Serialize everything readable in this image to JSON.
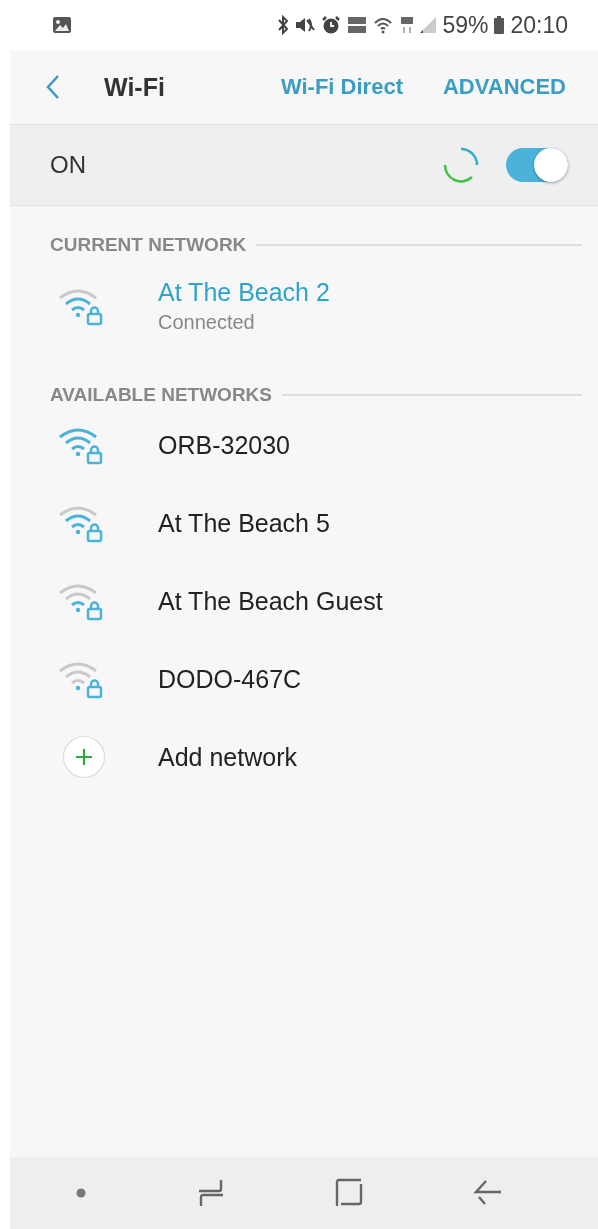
{
  "status_bar": {
    "battery": "59%",
    "time": "20:10"
  },
  "header": {
    "title": "Wi-Fi",
    "actions": [
      "Wi-Fi Direct",
      "ADVANCED"
    ]
  },
  "wifi_switch": {
    "label": "ON",
    "on": true
  },
  "current_section": {
    "heading": "CURRENT NETWORK",
    "network": {
      "name": "At The Beach 2",
      "status": "Connected",
      "kind": "good"
    }
  },
  "available_section": {
    "heading": "AVAILABLE NETWORKS",
    "networks": [
      {
        "name": "ORB-32030",
        "kind": "full"
      },
      {
        "name": "At The Beach 5",
        "kind": "good"
      },
      {
        "name": "At The Beach Guest",
        "kind": "fair"
      },
      {
        "name": "DODO-467C",
        "kind": "weak"
      }
    ],
    "add_label": "Add network"
  }
}
